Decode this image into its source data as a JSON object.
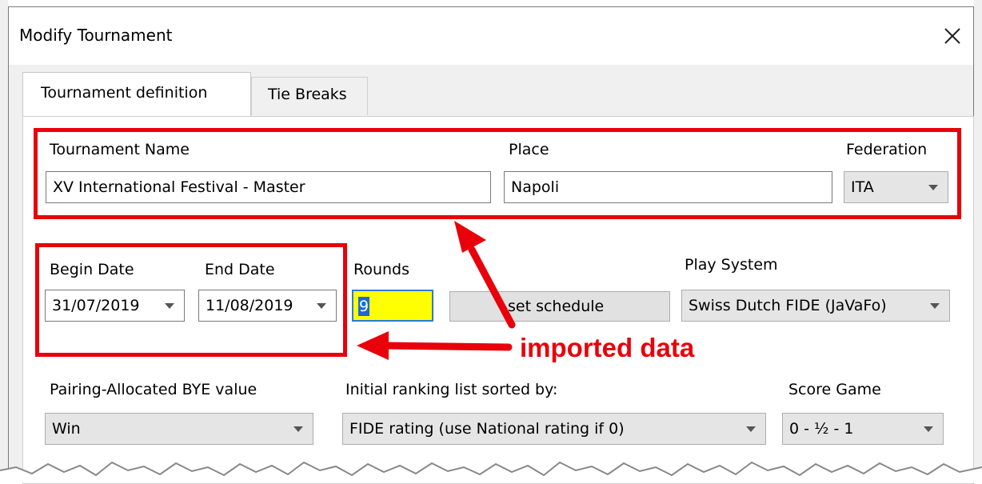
{
  "dialog": {
    "title": "Modify Tournament",
    "close_glyph": "✕"
  },
  "tabs": [
    {
      "label": "Tournament definition",
      "active": true
    },
    {
      "label": "Tie Breaks",
      "active": false
    }
  ],
  "fields": {
    "tournament_name": {
      "label": "Tournament Name",
      "value": "XV International Festival - Master"
    },
    "place": {
      "label": "Place",
      "value": "Napoli"
    },
    "federation": {
      "label": "Federation",
      "value": "ITA"
    },
    "begin_date": {
      "label": "Begin Date",
      "value": "31/07/2019"
    },
    "end_date": {
      "label": "End Date",
      "value": "11/08/2019"
    },
    "rounds": {
      "label": "Rounds",
      "value": "9"
    },
    "set_schedule": {
      "label": "set schedule"
    },
    "play_system": {
      "label": "Play System",
      "value": "Swiss Dutch FIDE (JaVaFo)"
    },
    "bye_value": {
      "label": "Pairing-Allocated BYE value",
      "value": "Win"
    },
    "ranking_sort": {
      "label": "Initial ranking list sorted by:",
      "value": "FIDE rating (use National rating if 0)"
    },
    "score_game": {
      "label": "Score Game",
      "value": "0 - ½ - 1"
    }
  },
  "annotation": {
    "text": "imported data",
    "color": "#e8000b"
  }
}
